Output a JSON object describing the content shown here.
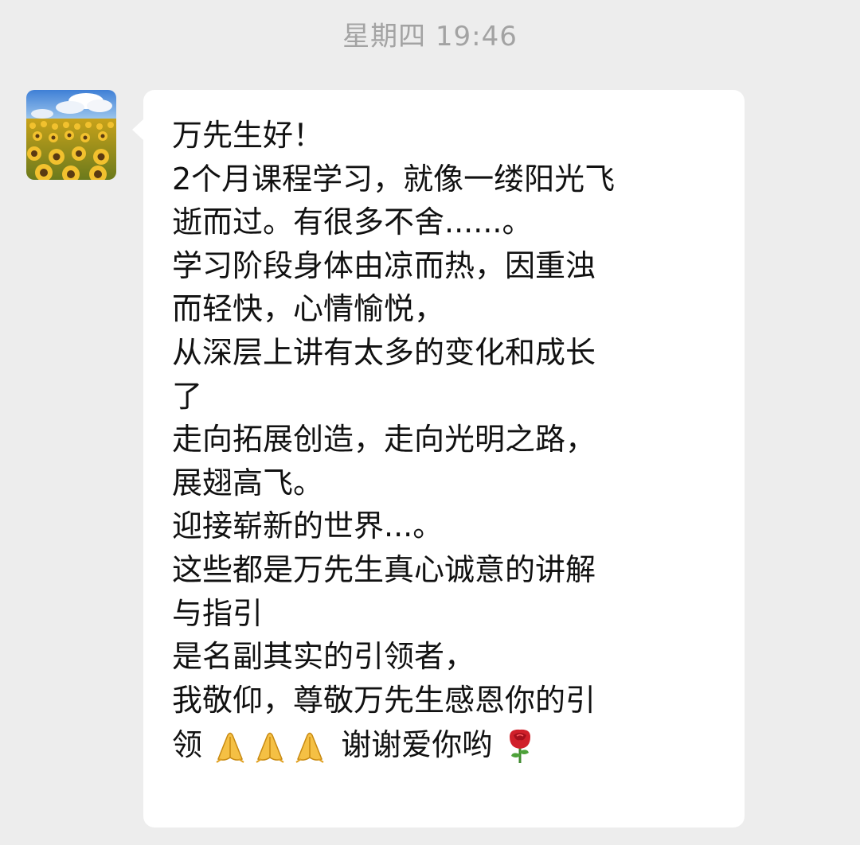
{
  "chat": {
    "timestamp": "星期四 19:46",
    "message": {
      "avatar_icon": "sunflower-field-avatar-icon",
      "lines": [
        "万先生好！",
        "2个月课程学习，就像一缕阳光飞",
        "逝而过。有很多不舍......。",
        "学习阶段身体由凉而热，因重浊",
        "而轻快，心情愉悦，",
        "从深层上讲有太多的变化和成长",
        "了",
        "走向拓展创造，走向光明之路，",
        "展翅高飞。",
        "迎接崭新的世界...。",
        "这些都是万先生真心诚意的讲解",
        "与指引",
        "是名副其实的引领者，",
        "我敬仰，尊敬万先生感恩你的引"
      ],
      "last_line_start": "领",
      "last_line_end": "谢谢爱你哟",
      "emojis": [
        "praying-hands-icon",
        "praying-hands-icon",
        "praying-hands-icon",
        "rose-icon"
      ]
    }
  }
}
